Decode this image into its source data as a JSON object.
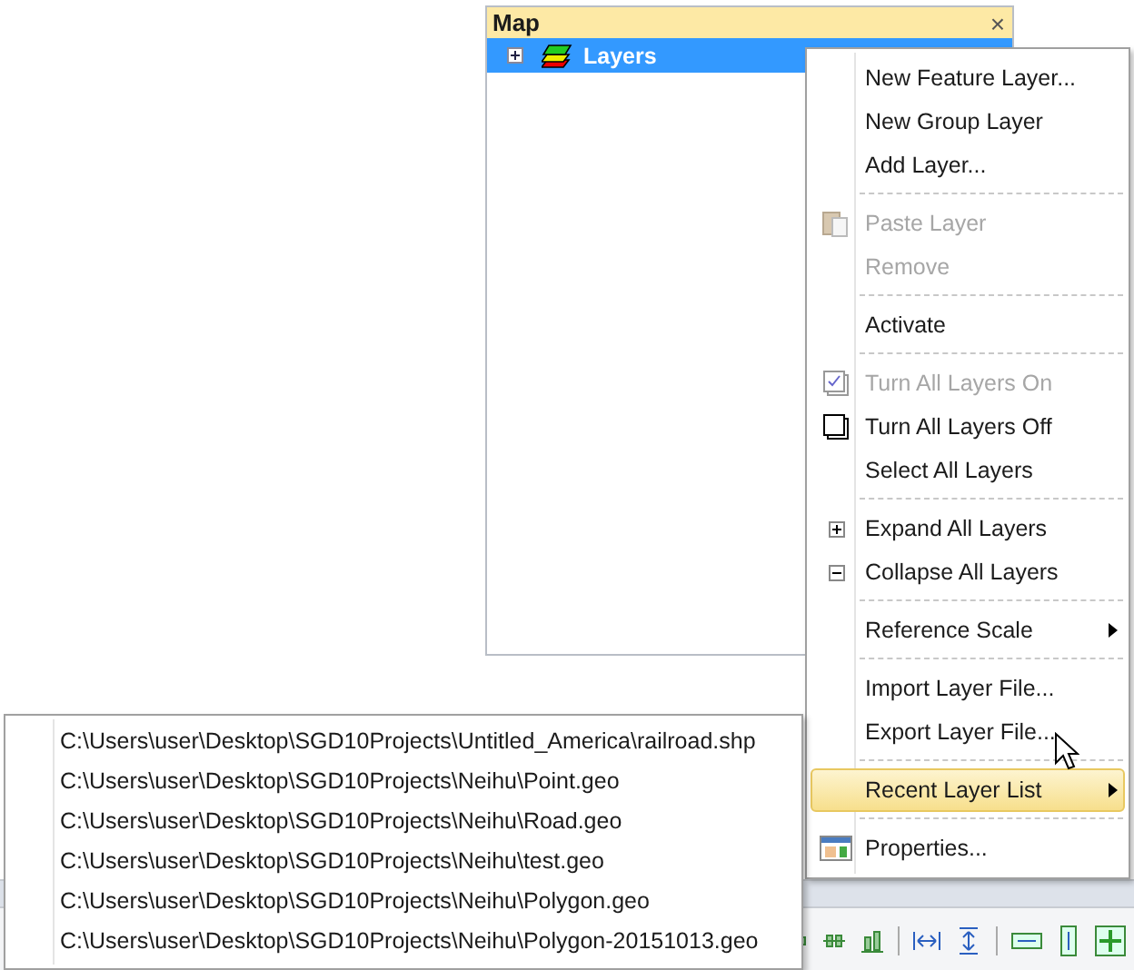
{
  "panel": {
    "title": "Map",
    "close": "×",
    "tree": [
      {
        "label": "Layers",
        "expanded": false,
        "selected": true
      }
    ]
  },
  "context_menu": {
    "items": [
      {
        "kind": "item",
        "label": "New Feature Layer...",
        "disabled": false,
        "selected": false,
        "submenu": false
      },
      {
        "kind": "item",
        "label": "New Group Layer",
        "disabled": false,
        "selected": false,
        "submenu": false
      },
      {
        "kind": "item",
        "label": "Add Layer...",
        "disabled": false,
        "selected": false,
        "submenu": false
      },
      {
        "kind": "separator"
      },
      {
        "kind": "item",
        "label": "Paste Layer",
        "disabled": true,
        "selected": false,
        "submenu": false
      },
      {
        "kind": "item",
        "label": "Remove",
        "disabled": true,
        "selected": false,
        "submenu": false
      },
      {
        "kind": "separator"
      },
      {
        "kind": "item",
        "label": "Activate",
        "disabled": false,
        "selected": false,
        "submenu": false
      },
      {
        "kind": "separator"
      },
      {
        "kind": "item",
        "label": "Turn All Layers On",
        "disabled": true,
        "selected": false,
        "submenu": false
      },
      {
        "kind": "item",
        "label": "Turn All Layers Off",
        "disabled": false,
        "selected": false,
        "submenu": false
      },
      {
        "kind": "item",
        "label": "Select All Layers",
        "disabled": false,
        "selected": false,
        "submenu": false
      },
      {
        "kind": "separator"
      },
      {
        "kind": "item",
        "label": "Expand All Layers",
        "disabled": false,
        "selected": false,
        "submenu": false
      },
      {
        "kind": "item",
        "label": "Collapse All Layers",
        "disabled": false,
        "selected": false,
        "submenu": false
      },
      {
        "kind": "separator"
      },
      {
        "kind": "item",
        "label": "Reference Scale",
        "disabled": false,
        "selected": false,
        "submenu": true
      },
      {
        "kind": "separator"
      },
      {
        "kind": "item",
        "label": "Import Layer File...",
        "disabled": false,
        "selected": false,
        "submenu": false
      },
      {
        "kind": "item",
        "label": "Export Layer File...",
        "disabled": false,
        "selected": false,
        "submenu": false
      },
      {
        "kind": "separator"
      },
      {
        "kind": "item",
        "label": "Recent Layer List",
        "disabled": false,
        "selected": true,
        "submenu": true
      },
      {
        "kind": "separator"
      },
      {
        "kind": "item",
        "label": "Properties...",
        "disabled": false,
        "selected": false,
        "submenu": false
      }
    ]
  },
  "recent_layers": [
    "C:\\Users\\user\\Desktop\\SGD10Projects\\Untitled_America\\railroad.shp",
    "C:\\Users\\user\\Desktop\\SGD10Projects\\Neihu\\Point.geo",
    "C:\\Users\\user\\Desktop\\SGD10Projects\\Neihu\\Road.geo",
    "C:\\Users\\user\\Desktop\\SGD10Projects\\Neihu\\test.geo",
    "C:\\Users\\user\\Desktop\\SGD10Projects\\Neihu\\Polygon.geo",
    "C:\\Users\\user\\Desktop\\SGD10Projects\\Neihu\\Polygon-20151013.geo"
  ]
}
